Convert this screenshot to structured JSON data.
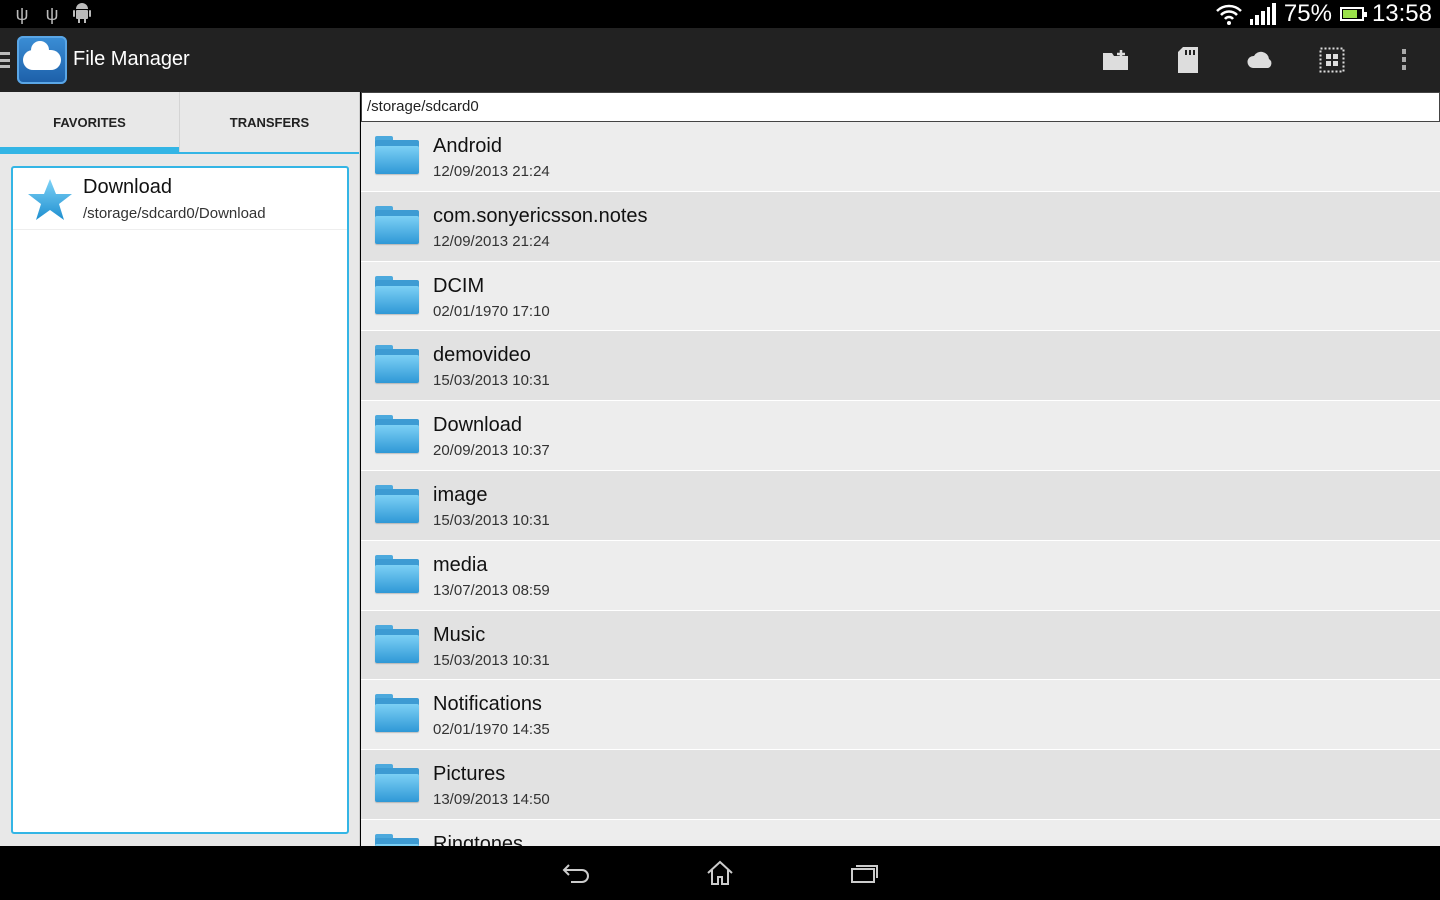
{
  "status_bar": {
    "battery_text": "75%",
    "time": "13:58",
    "battery_level": 0.75,
    "left_icons": [
      "usb-icon",
      "usb-debug-icon",
      "android-icon"
    ]
  },
  "action_bar": {
    "title": "File Manager",
    "actions": [
      "new-folder-icon",
      "sd-card-icon",
      "cloud-icon",
      "select-all-icon",
      "overflow-menu-icon"
    ]
  },
  "left_pane": {
    "tabs": [
      {
        "label": "FAVORITES",
        "active": true
      },
      {
        "label": "TRANSFERS",
        "active": false
      }
    ],
    "favorites": [
      {
        "name": "Download",
        "path": "/storage/sdcard0/Download"
      }
    ]
  },
  "right_pane": {
    "current_path": "/storage/sdcard0",
    "files": [
      {
        "name": "Android",
        "date": "12/09/2013 21:24"
      },
      {
        "name": "com.sonyericsson.notes",
        "date": "12/09/2013 21:24"
      },
      {
        "name": "DCIM",
        "date": "02/01/1970 17:10"
      },
      {
        "name": "demovideo",
        "date": "15/03/2013 10:31"
      },
      {
        "name": "Download",
        "date": "20/09/2013 10:37"
      },
      {
        "name": "image",
        "date": "15/03/2013 10:31"
      },
      {
        "name": "media",
        "date": "13/07/2013 08:59"
      },
      {
        "name": "Music",
        "date": "15/03/2013 10:31"
      },
      {
        "name": "Notifications",
        "date": "02/01/1970 14:35"
      },
      {
        "name": "Pictures",
        "date": "13/09/2013 14:50"
      },
      {
        "name": "Ringtones",
        "date": ""
      }
    ]
  },
  "nav_bar": {
    "buttons": [
      "back-icon",
      "home-icon",
      "recent-apps-icon"
    ]
  },
  "colors": {
    "accent": "#33b5e5",
    "action_bar": "#222222",
    "folder": "#3d9bd3"
  }
}
